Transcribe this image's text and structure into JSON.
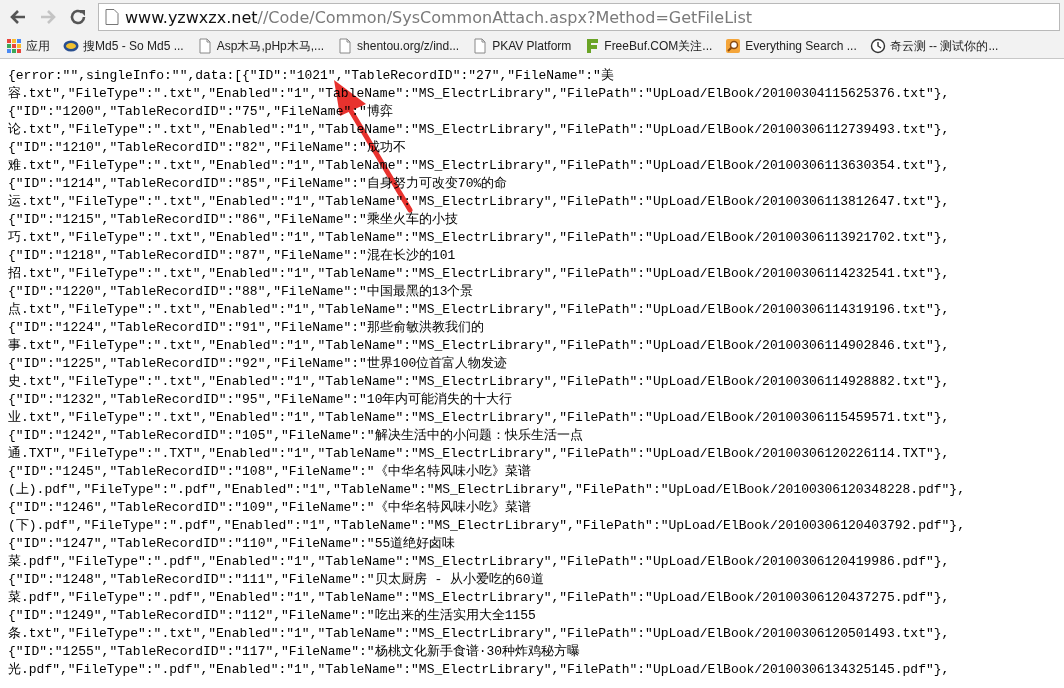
{
  "toolbar": {
    "back_disabled": false,
    "forward_disabled": true,
    "address": {
      "host": "www.yzwxzx.net",
      "path": "//Code/Common/SysCommonAttach.aspx?Method=GetFileList"
    }
  },
  "bookmarks": [
    {
      "kind": "apps",
      "label": "应用"
    },
    {
      "kind": "site",
      "label": "搜Md5 - So Md5 ..."
    },
    {
      "kind": "page",
      "label": "Asp木马,pHp木马,..."
    },
    {
      "kind": "page",
      "label": "shentou.org/z/ind..."
    },
    {
      "kind": "page",
      "label": "PKAV Platform"
    },
    {
      "kind": "letter",
      "label": "FreeBuf.COM关注..."
    },
    {
      "kind": "search",
      "label": "Everything Search ..."
    },
    {
      "kind": "clock",
      "label": "奇云测 -- 测试你的..."
    }
  ],
  "content": {
    "lines": [
      "{error:\"\",singleInfo:\"\",data:[{\"ID\":\"1021\",\"TableRecordID\":\"27\",\"FileName\":\"美",
      "容.txt\",\"FileType\":\".txt\",\"Enabled\":\"1\",\"TableName\":\"MS_ElectrLibrary\",\"FilePath\":\"UpLoad/ElBook/20100304115625376.txt\"},",
      "{\"ID\":\"1200\",\"TableRecordID\":\"75\",\"FileName\":\"博弈",
      "论.txt\",\"FileType\":\".txt\",\"Enabled\":\"1\",\"TableName\":\"MS_ElectrLibrary\",\"FilePath\":\"UpLoad/ElBook/20100306112739493.txt\"},",
      "{\"ID\":\"1210\",\"TableRecordID\":\"82\",\"FileName\":\"成功不",
      "难.txt\",\"FileType\":\".txt\",\"Enabled\":\"1\",\"TableName\":\"MS_ElectrLibrary\",\"FilePath\":\"UpLoad/ElBook/20100306113630354.txt\"},",
      "{\"ID\":\"1214\",\"TableRecordID\":\"85\",\"FileName\":\"自身努力可改变70%的命",
      "运.txt\",\"FileType\":\".txt\",\"Enabled\":\"1\",\"TableName\":\"MS_ElectrLibrary\",\"FilePath\":\"UpLoad/ElBook/20100306113812647.txt\"},",
      "{\"ID\":\"1215\",\"TableRecordID\":\"86\",\"FileName\":\"乘坐火车的小技",
      "巧.txt\",\"FileType\":\".txt\",\"Enabled\":\"1\",\"TableName\":\"MS_ElectrLibrary\",\"FilePath\":\"UpLoad/ElBook/20100306113921702.txt\"},",
      "{\"ID\":\"1218\",\"TableRecordID\":\"87\",\"FileName\":\"混在长沙的101",
      "招.txt\",\"FileType\":\".txt\",\"Enabled\":\"1\",\"TableName\":\"MS_ElectrLibrary\",\"FilePath\":\"UpLoad/ElBook/20100306114232541.txt\"},",
      "{\"ID\":\"1220\",\"TableRecordID\":\"88\",\"FileName\":\"中国最黑的13个景",
      "点.txt\",\"FileType\":\".txt\",\"Enabled\":\"1\",\"TableName\":\"MS_ElectrLibrary\",\"FilePath\":\"UpLoad/ElBook/20100306114319196.txt\"},",
      "{\"ID\":\"1224\",\"TableRecordID\":\"91\",\"FileName\":\"那些俞敏洪教我们的",
      "事.txt\",\"FileType\":\".txt\",\"Enabled\":\"1\",\"TableName\":\"MS_ElectrLibrary\",\"FilePath\":\"UpLoad/ElBook/20100306114902846.txt\"},",
      "{\"ID\":\"1225\",\"TableRecordID\":\"92\",\"FileName\":\"世界100位首富人物发迹",
      "史.txt\",\"FileType\":\".txt\",\"Enabled\":\"1\",\"TableName\":\"MS_ElectrLibrary\",\"FilePath\":\"UpLoad/ElBook/20100306114928882.txt\"},",
      "{\"ID\":\"1232\",\"TableRecordID\":\"95\",\"FileName\":\"10年内可能消失的十大行",
      "业.txt\",\"FileType\":\".txt\",\"Enabled\":\"1\",\"TableName\":\"MS_ElectrLibrary\",\"FilePath\":\"UpLoad/ElBook/20100306115459571.txt\"},",
      "{\"ID\":\"1242\",\"TableRecordID\":\"105\",\"FileName\":\"解决生活中的小问题：快乐生活一点",
      "通.TXT\",\"FileType\":\".TXT\",\"Enabled\":\"1\",\"TableName\":\"MS_ElectrLibrary\",\"FilePath\":\"UpLoad/ElBook/20100306120226114.TXT\"},",
      "{\"ID\":\"1245\",\"TableRecordID\":\"108\",\"FileName\":\"《中华名特风味小吃》菜谱",
      "(上).pdf\",\"FileType\":\".pdf\",\"Enabled\":\"1\",\"TableName\":\"MS_ElectrLibrary\",\"FilePath\":\"UpLoad/ElBook/20100306120348228.pdf\"},",
      "{\"ID\":\"1246\",\"TableRecordID\":\"109\",\"FileName\":\"《中华名特风味小吃》菜谱",
      "(下).pdf\",\"FileType\":\".pdf\",\"Enabled\":\"1\",\"TableName\":\"MS_ElectrLibrary\",\"FilePath\":\"UpLoad/ElBook/20100306120403792.pdf\"},",
      "{\"ID\":\"1247\",\"TableRecordID\":\"110\",\"FileName\":\"55道绝好卤味",
      "菜.pdf\",\"FileType\":\".pdf\",\"Enabled\":\"1\",\"TableName\":\"MS_ElectrLibrary\",\"FilePath\":\"UpLoad/ElBook/20100306120419986.pdf\"},",
      "{\"ID\":\"1248\",\"TableRecordID\":\"111\",\"FileName\":\"贝太厨房 - 从小爱吃的60道",
      "菜.pdf\",\"FileType\":\".pdf\",\"Enabled\":\"1\",\"TableName\":\"MS_ElectrLibrary\",\"FilePath\":\"UpLoad/ElBook/20100306120437275.pdf\"},",
      "{\"ID\":\"1249\",\"TableRecordID\":\"112\",\"FileName\":\"吃出来的生活实用大全1155",
      "条.txt\",\"FileType\":\".txt\",\"Enabled\":\"1\",\"TableName\":\"MS_ElectrLibrary\",\"FilePath\":\"UpLoad/ElBook/20100306120501493.txt\"},",
      "{\"ID\":\"1255\",\"TableRecordID\":\"117\",\"FileName\":\"杨桃文化新手食谱·30种炸鸡秘方曝",
      "光.pdf\",\"FileType\":\".pdf\",\"Enabled\":\"1\",\"TableName\":\"MS_ElectrLibrary\",\"FilePath\":\"UpLoad/ElBook/20100306134325145.pdf\"},"
    ]
  }
}
